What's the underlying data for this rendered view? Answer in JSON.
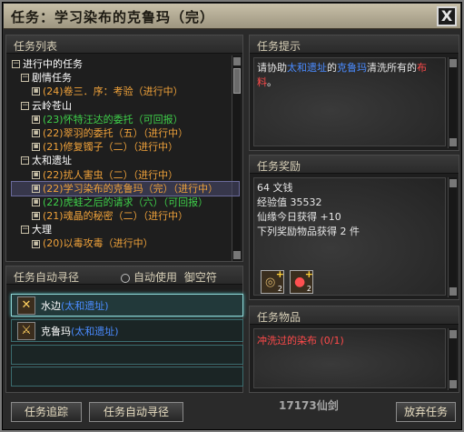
{
  "window": {
    "title": "任务：学习染布的克鲁玛（完）",
    "close_label": "X"
  },
  "task_list": {
    "header": "任务列表",
    "groups": [
      {
        "label": "进行中的任务",
        "level": 1
      },
      {
        "label": "剧情任务",
        "level": 2
      },
      {
        "label": "(24)卷三．序：考验（进行中）",
        "level": 3,
        "color": "orange"
      },
      {
        "label": "云岭苍山",
        "level": 2
      },
      {
        "label": "(23)怀特汪达的委托（可回报）",
        "level": 3,
        "color": "green"
      },
      {
        "label": "(22)翠羽的委托（五）（进行中）",
        "level": 3,
        "color": "orange"
      },
      {
        "label": "(21)修复镯子（二）（进行中）",
        "level": 3,
        "color": "orange"
      },
      {
        "label": "太和遗址",
        "level": 2
      },
      {
        "label": "(22)扰人害虫（二）（进行中）",
        "level": 3,
        "color": "orange"
      },
      {
        "label": "(22)学习染布的克鲁玛（完）（进行中）",
        "level": 3,
        "color": "orange",
        "selected": true
      },
      {
        "label": "(22)虎蛙之后的请求（六）（可回报）",
        "level": 3,
        "color": "green"
      },
      {
        "label": "(21)魂晶的秘密（二）（进行中）",
        "level": 3,
        "color": "orange"
      },
      {
        "label": "大理",
        "level": 2
      },
      {
        "label": "(20)以毒攻毒（进行中）",
        "level": 3,
        "color": "orange"
      }
    ]
  },
  "auto_path": {
    "header": "任务自动寻径",
    "auto_use_label": "自动使用",
    "item_label": "御空符",
    "rows": [
      {
        "name": "水边",
        "loc": "(太和遗址)",
        "icon": "crossed-swords-icon"
      },
      {
        "name": "克鲁玛",
        "loc": "(太和遗址)",
        "icon": "person-icon"
      }
    ]
  },
  "hint": {
    "header": "任务提示",
    "text_pre": "请协助",
    "place": "太和遗址",
    "mid": "的",
    "npc": "克鲁玛",
    "post": "清洗所有的",
    "target": "布料",
    "end": "。"
  },
  "reward": {
    "header": "任务奖励",
    "lines": [
      "64 文钱",
      "经验值 35532",
      "仙缘今日获得 +10",
      "下列奖励物品获得 2 件"
    ],
    "items": [
      {
        "count": "2"
      },
      {
        "count": "2"
      }
    ]
  },
  "items": {
    "header": "任务物品",
    "list": [
      "冲洗过的染布 (0/1)"
    ]
  },
  "buttons": {
    "track": "任务追踪",
    "autopath": "任务自动寻径",
    "abandon": "放弃任务"
  },
  "watermark": "17173仙剑"
}
